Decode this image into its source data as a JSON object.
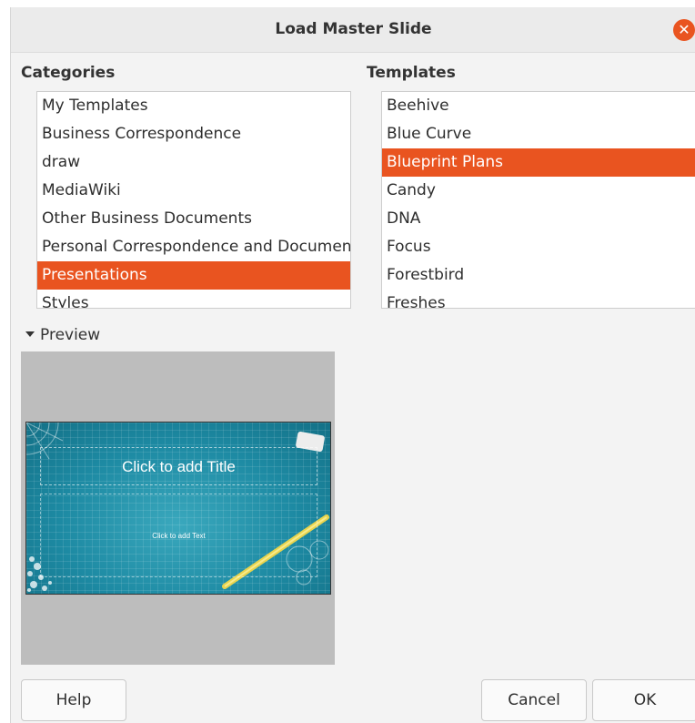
{
  "dialog": {
    "title": "Load Master Slide"
  },
  "categories": {
    "label": "Categories",
    "selected_index": 6,
    "items": [
      "My Templates",
      "Business Correspondence",
      "draw",
      "MediaWiki",
      "Other Business Documents",
      "Personal Correspondence and Documents",
      "Presentations",
      "Styles"
    ]
  },
  "templates": {
    "label": "Templates",
    "selected_index": 2,
    "items": [
      "Beehive",
      "Blue Curve",
      "Blueprint Plans",
      "Candy",
      "DNA",
      "Focus",
      "Forestbird",
      "Freshes"
    ]
  },
  "preview": {
    "toggle_label": "Preview",
    "slide_title": "Click to add Title",
    "slide_text": "Click to add Text"
  },
  "buttons": {
    "help": "Help",
    "cancel": "Cancel",
    "ok": "OK"
  },
  "colors": {
    "accent": "#e95420",
    "slide_bg": "#1d8aa3"
  }
}
